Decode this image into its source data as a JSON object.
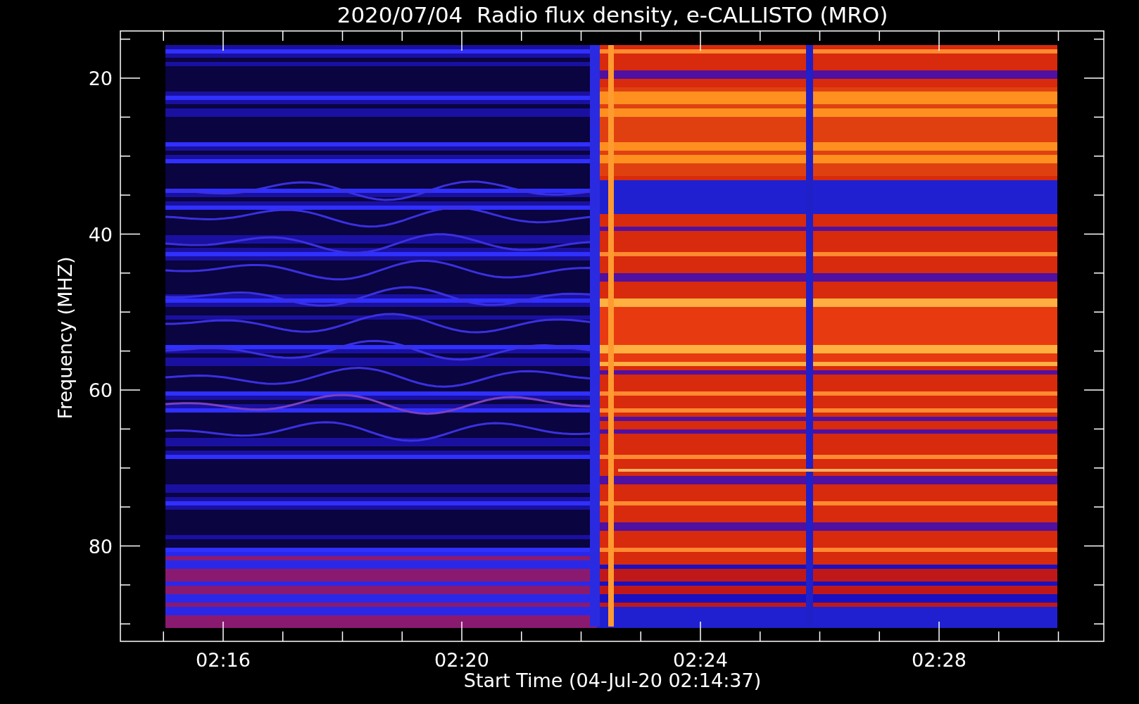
{
  "title": "2020/07/04  Radio flux density, e-CALLISTO (MRO)",
  "y_axis": {
    "label": "Frequency (MHZ)",
    "ticks": [
      "20",
      "40",
      "60",
      "80"
    ]
  },
  "x_axis": {
    "label": "Start Time (04-Jul-20 02:14:37)",
    "ticks": [
      "02:16",
      "02:20",
      "02:24",
      "02:28"
    ]
  }
}
